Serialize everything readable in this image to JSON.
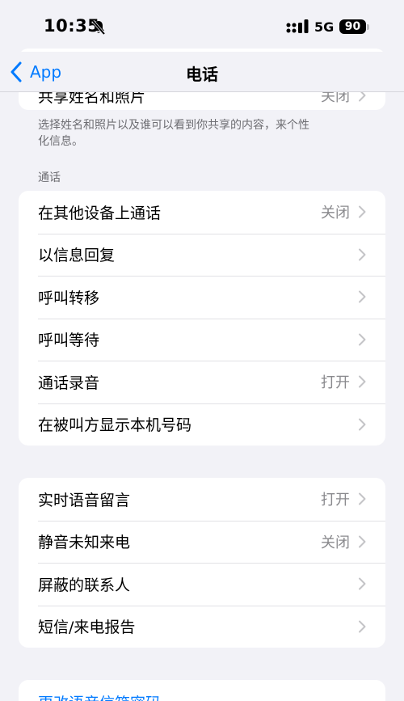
{
  "status_bar": {
    "time": "10:35",
    "network": "5G",
    "battery": "90"
  },
  "nav": {
    "back_label": "App",
    "title": "电话"
  },
  "share_section": {
    "row_label": "共享姓名和照片",
    "row_value": "关闭",
    "footer": "选择姓名和照片以及谁可以看到你共享的内容，来个性化信息。"
  },
  "calls_section": {
    "header": "通话",
    "rows": [
      {
        "label": "在其他设备上通话",
        "value": "关闭"
      },
      {
        "label": "以信息回复",
        "value": ""
      },
      {
        "label": "呼叫转移",
        "value": ""
      },
      {
        "label": "呼叫等待",
        "value": ""
      },
      {
        "label": "通话录音",
        "value": "打开"
      },
      {
        "label": "在被叫方显示本机号码",
        "value": ""
      }
    ]
  },
  "second_section": {
    "rows": [
      {
        "label": "实时语音留言",
        "value": "打开"
      },
      {
        "label": "静音未知来电",
        "value": "关闭"
      },
      {
        "label": "屏蔽的联系人",
        "value": ""
      },
      {
        "label": "短信/来电报告",
        "value": ""
      }
    ]
  },
  "third_section": {
    "link_label": "更改语音信箱密码"
  },
  "colors": {
    "accent": "#007aff",
    "background": "#f2f2f7",
    "secondary_text": "#8a8a8e"
  }
}
